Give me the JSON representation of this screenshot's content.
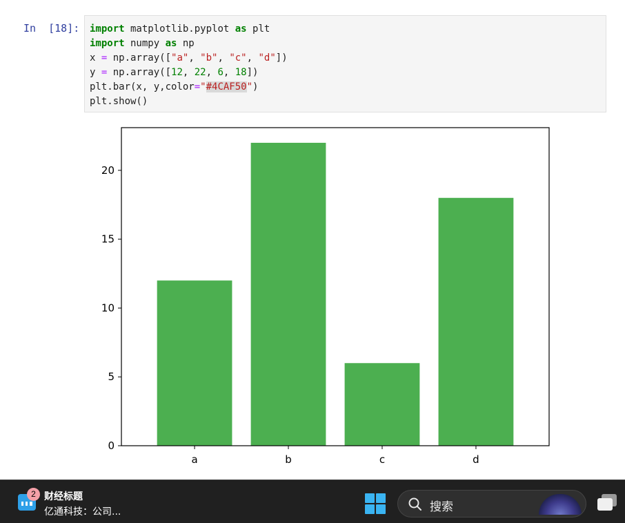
{
  "notebook": {
    "prompt": "In  [18]:",
    "code_lines": [
      [
        {
          "t": "import",
          "c": "kw"
        },
        {
          "t": " matplotlib.pyplot "
        },
        {
          "t": "as",
          "c": "kw"
        },
        {
          "t": " plt"
        }
      ],
      [
        {
          "t": "import",
          "c": "kw"
        },
        {
          "t": " numpy "
        },
        {
          "t": "as",
          "c": "kw"
        },
        {
          "t": " np"
        }
      ],
      [
        {
          "t": "x "
        },
        {
          "t": "=",
          "c": "op"
        },
        {
          "t": " np.array(["
        },
        {
          "t": "\"a\"",
          "c": "str"
        },
        {
          "t": ", "
        },
        {
          "t": "\"b\"",
          "c": "str"
        },
        {
          "t": ", "
        },
        {
          "t": "\"c\"",
          "c": "str"
        },
        {
          "t": ", "
        },
        {
          "t": "\"d\"",
          "c": "str"
        },
        {
          "t": "])"
        }
      ],
      [
        {
          "t": "y "
        },
        {
          "t": "=",
          "c": "op"
        },
        {
          "t": " np.array(["
        },
        {
          "t": "12",
          "c": "num"
        },
        {
          "t": ", "
        },
        {
          "t": "22",
          "c": "num"
        },
        {
          "t": ", "
        },
        {
          "t": "6",
          "c": "num"
        },
        {
          "t": ", "
        },
        {
          "t": "18",
          "c": "num"
        },
        {
          "t": "])"
        }
      ],
      [
        {
          "t": "plt.bar(x, y,color"
        },
        {
          "t": "=",
          "c": "op"
        },
        {
          "t": "\"",
          "c": "str"
        },
        {
          "t": "#4CAF50",
          "c": "str hl"
        },
        {
          "t": "\"",
          "c": "str"
        },
        {
          "t": ")"
        }
      ],
      [
        {
          "t": "plt.show()"
        }
      ]
    ]
  },
  "chart_data": {
    "type": "bar",
    "categories": [
      "a",
      "b",
      "c",
      "d"
    ],
    "values": [
      12,
      22,
      6,
      18
    ],
    "color": "#4CAF50",
    "title": "",
    "xlabel": "",
    "ylabel": "",
    "yticks": [
      0,
      5,
      10,
      15,
      20
    ],
    "ylim": [
      0,
      23.1
    ],
    "grid": false
  },
  "taskbar": {
    "widget_badge": "2",
    "news_title": "财经标题",
    "news_subtitle": "亿通科技：公司...",
    "search_label": "搜索",
    "background": "#202020",
    "start_icon_color": "#3ab4f2"
  }
}
